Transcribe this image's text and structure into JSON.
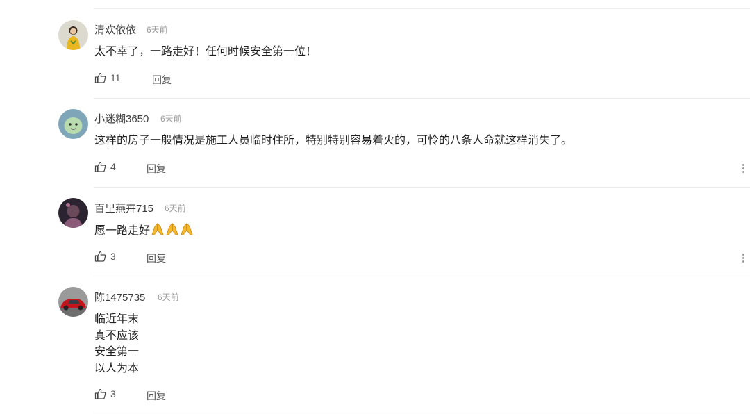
{
  "comments": [
    {
      "username": "清欢依依",
      "time": "6天前",
      "text_lines": [
        "太不幸了，一路走好！任何时候安全第一位！"
      ],
      "likes": "11",
      "reply": "回复",
      "avatar": "avatar-yellow-figure"
    },
    {
      "username": "小迷糊3650",
      "time": "6天前",
      "text_lines": [
        "这样的房子一般情况是施工人员临时住所，特别特别容易着火的，可怜的八条人命就这样消失了。"
      ],
      "likes": "4",
      "reply": "回复",
      "avatar": "avatar-green-cartoon"
    },
    {
      "username": "百里燕卉715",
      "time": "6天前",
      "text_lines": [
        "愿一路走好"
      ],
      "emoji": [
        "folded-hands",
        "folded-hands",
        "folded-hands"
      ],
      "likes": "3",
      "reply": "回复",
      "avatar": "avatar-dark-portrait"
    },
    {
      "username": "陈1475735",
      "time": "6天前",
      "text_lines": [
        "临近年末",
        "真不应该",
        "安全第一",
        "以人为本"
      ],
      "likes": "3",
      "reply": "回复",
      "avatar": "avatar-red-car"
    }
  ],
  "icons": {
    "like": "thumbs-up-icon",
    "more": "more-vertical-icon",
    "emoji": "folded-hands-emoji"
  },
  "colors": {
    "username": "#3b3b3b",
    "time": "#9a9a9a",
    "text": "#1f1f1f",
    "divider": "#ececec"
  }
}
